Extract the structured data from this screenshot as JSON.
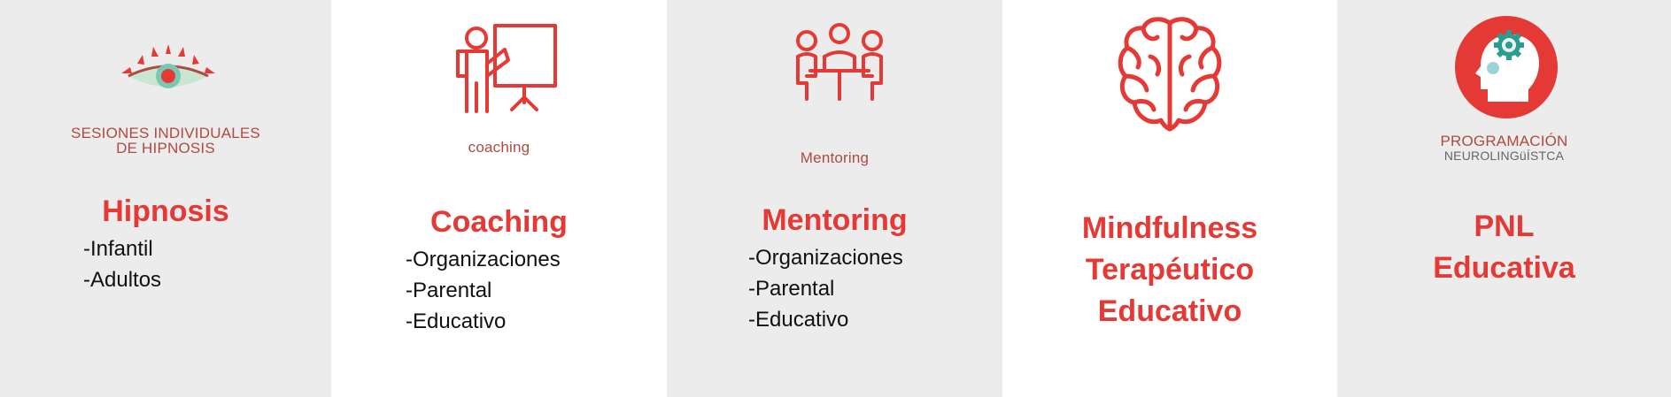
{
  "columns": [
    {
      "id": "hipnosis",
      "icon": "eye-icon",
      "caption_lines": [
        "SESIONES INDIVIDUALES",
        "DE HIPNOSIS"
      ],
      "title_lines": [
        "Hipnosis"
      ],
      "items": [
        "-Infantil",
        "-Adultos"
      ]
    },
    {
      "id": "coaching",
      "icon": "presenter-board-icon",
      "caption_lines": [
        "coaching"
      ],
      "title_lines": [
        "Coaching"
      ],
      "items": [
        "-Organizaciones",
        "-Parental",
        "-Educativo"
      ]
    },
    {
      "id": "mentoring",
      "icon": "meeting-table-icon",
      "caption_lines": [
        "Mentoring"
      ],
      "title_lines": [
        "Mentoring"
      ],
      "items": [
        "-Organizaciones",
        "-Parental",
        "-Educativo"
      ]
    },
    {
      "id": "mindfulness",
      "icon": "brain-icon",
      "caption_lines": [],
      "title_lines": [
        "Mindfulness",
        "Terapéutico",
        "Educativo"
      ],
      "items": []
    },
    {
      "id": "pnl",
      "icon": "head-gear-icon",
      "caption_lines": [
        "PROGRAMACIÓN",
        "NEUROLINGüÍSTCA"
      ],
      "title_lines": [
        "PNL",
        "Educativa"
      ],
      "items": []
    }
  ],
  "colors": {
    "accent": "#e53935",
    "caption": "#b04a3f",
    "grey_bg": "#ececec",
    "white_bg": "#ffffff",
    "text": "#111111"
  }
}
